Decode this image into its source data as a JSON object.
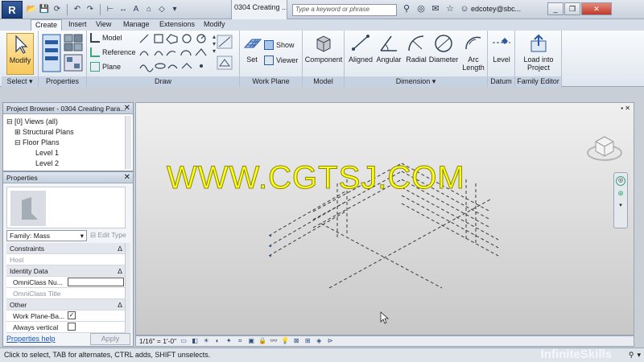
{
  "app": {
    "menu_button_label": "R",
    "document_title": "0304 Creating ...",
    "search_placeholder": "Type a keyword or phrase",
    "user": "edcotey@sbc..."
  },
  "ribbon": {
    "tabs": [
      "Create",
      "Insert",
      "View",
      "Manage",
      "Extensions",
      "Modify"
    ],
    "active_tab": "Create",
    "select": {
      "modify": "Modify",
      "panel": "Select"
    },
    "properties_panel": "Properties",
    "draw": {
      "model": "Model",
      "reference": "Reference",
      "plane": "Plane",
      "panel": "Draw"
    },
    "work_plane": {
      "set": "Set",
      "show": "Show",
      "viewer": "Viewer",
      "panel": "Work Plane"
    },
    "model": {
      "component": "Component",
      "panel": "Model"
    },
    "dimension": {
      "aligned": "Aligned",
      "angular": "Angular",
      "radial": "Radial",
      "diameter": "Diameter",
      "arc_length_1": "Arc",
      "arc_length_2": "Length",
      "panel": "Dimension"
    },
    "datum": {
      "level": "Level",
      "panel": "Datum"
    },
    "family_editor": {
      "load_1": "Load into",
      "load_2": "Project",
      "panel": "Family Editor"
    }
  },
  "project_browser": {
    "title": "Project Browser - 0304 Creating Para...",
    "items": [
      "Views (all)",
      "Structural Plans",
      "Floor Plans",
      "Level 1",
      "Level 2"
    ]
  },
  "properties": {
    "title": "Properties",
    "family": "Family: Mass",
    "edit_type": "Edit Type",
    "sections": {
      "constraints": "Constraints",
      "host": "Host",
      "identity": "Identity Data",
      "omniclass_number": "OmniClass Nu...",
      "omniclass_title": "OmniClass Title",
      "other": "Other",
      "work_plane_based": "Work Plane-Ba...",
      "always_vertical": "Always vertical"
    },
    "help_link": "Properties help",
    "apply": "Apply"
  },
  "canvas": {
    "watermark": "WWW.CGTSJ.COM",
    "scale": "1/16\" = 1'-0\"",
    "brand": "InfiniteSkills"
  },
  "status": {
    "message": "Click to select, TAB for alternates, CTRL adds, SHIFT unselects."
  },
  "colors": {
    "accent": "#173a78",
    "watermark": "#ffff1a",
    "active_button": "#f7c85d"
  }
}
